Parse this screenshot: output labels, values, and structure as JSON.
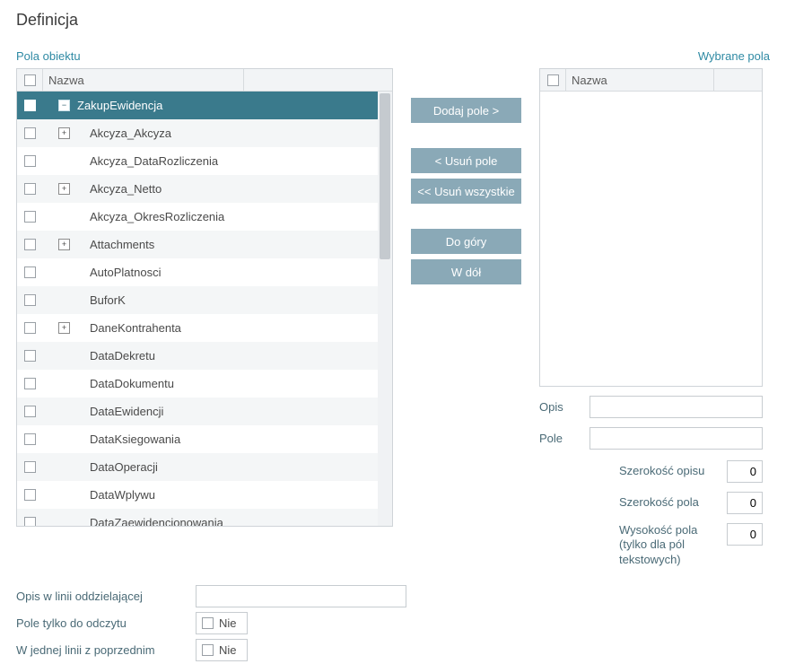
{
  "title": "Definicja",
  "sections": {
    "left": "Pola obiektu",
    "right": "Wybrane pola"
  },
  "left_grid": {
    "header": {
      "name": "Nazwa"
    },
    "rows": [
      {
        "label": "ZakupEwidencja",
        "expander": "minus",
        "selected": true
      },
      {
        "label": "Akcyza_Akcyza",
        "expander": "plus"
      },
      {
        "label": "Akcyza_DataRozliczenia"
      },
      {
        "label": "Akcyza_Netto",
        "expander": "plus"
      },
      {
        "label": "Akcyza_OkresRozliczenia"
      },
      {
        "label": "Attachments",
        "expander": "plus"
      },
      {
        "label": "AutoPlatnosci"
      },
      {
        "label": "BuforK"
      },
      {
        "label": "DaneKontrahenta",
        "expander": "plus"
      },
      {
        "label": "DataDekretu"
      },
      {
        "label": "DataDokumentu"
      },
      {
        "label": "DataEwidencji"
      },
      {
        "label": "DataKsiegowania"
      },
      {
        "label": "DataOperacji"
      },
      {
        "label": "DataWplywu"
      },
      {
        "label": "DataZaewidencjonowania"
      }
    ]
  },
  "right_grid": {
    "header": {
      "name": "Nazwa"
    }
  },
  "buttons": {
    "add": "Dodaj pole >",
    "remove": "< Usuń pole",
    "remove_all": "<< Usuń wszystkie",
    "up": "Do góry",
    "down": "W dół"
  },
  "right_form": {
    "opis_label": "Opis",
    "opis_value": "",
    "pole_label": "Pole",
    "pole_value": "",
    "szer_opisu_label": "Szerokość opisu",
    "szer_opisu_value": "0",
    "szer_pola_label": "Szerokość pola",
    "szer_pola_value": "0",
    "wys_pola_label": "Wysokość pola (tylko dla pól tekstowych)",
    "wys_pola_value": "0"
  },
  "bottom_form": {
    "sep_label": "Opis w linii oddzielającej",
    "sep_value": "",
    "readonly_label": "Pole tylko do odczytu",
    "readonly_value": "Nie",
    "sameline_label": "W jednej linii z poprzednim",
    "sameline_value": "Nie"
  }
}
